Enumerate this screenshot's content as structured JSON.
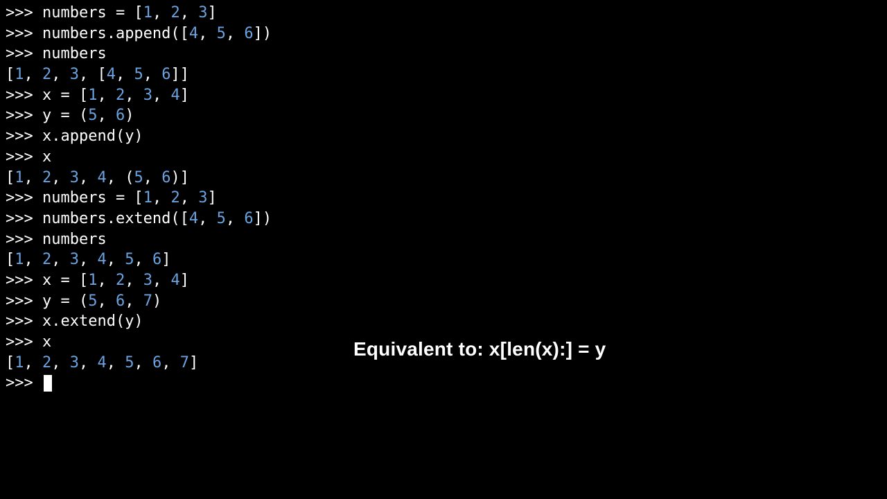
{
  "prompt": ">>> ",
  "lines": [
    {
      "type": "input",
      "tokens": [
        "numbers = [",
        {
          "n": "1"
        },
        ", ",
        {
          "n": "2"
        },
        ", ",
        {
          "n": "3"
        },
        "]"
      ]
    },
    {
      "type": "input",
      "tokens": [
        "numbers.append([",
        {
          "n": "4"
        },
        ", ",
        {
          "n": "5"
        },
        ", ",
        {
          "n": "6"
        },
        "])"
      ]
    },
    {
      "type": "input",
      "tokens": [
        "numbers"
      ]
    },
    {
      "type": "output",
      "tokens": [
        "[",
        {
          "n": "1"
        },
        ", ",
        {
          "n": "2"
        },
        ", ",
        {
          "n": "3"
        },
        ", [",
        {
          "n": "4"
        },
        ", ",
        {
          "n": "5"
        },
        ", ",
        {
          "n": "6"
        },
        "]]"
      ]
    },
    {
      "type": "input",
      "tokens": [
        "x = [",
        {
          "n": "1"
        },
        ", ",
        {
          "n": "2"
        },
        ", ",
        {
          "n": "3"
        },
        ", ",
        {
          "n": "4"
        },
        "]"
      ]
    },
    {
      "type": "input",
      "tokens": [
        "y = (",
        {
          "n": "5"
        },
        ", ",
        {
          "n": "6"
        },
        ")"
      ]
    },
    {
      "type": "input",
      "tokens": [
        "x.append(y)"
      ]
    },
    {
      "type": "input",
      "tokens": [
        "x"
      ]
    },
    {
      "type": "output",
      "tokens": [
        "[",
        {
          "n": "1"
        },
        ", ",
        {
          "n": "2"
        },
        ", ",
        {
          "n": "3"
        },
        ", ",
        {
          "n": "4"
        },
        ", (",
        {
          "n": "5"
        },
        ", ",
        {
          "n": "6"
        },
        ")]"
      ]
    },
    {
      "type": "input",
      "tokens": [
        "numbers = [",
        {
          "n": "1"
        },
        ", ",
        {
          "n": "2"
        },
        ", ",
        {
          "n": "3"
        },
        "]"
      ]
    },
    {
      "type": "input",
      "tokens": [
        "numbers.extend([",
        {
          "n": "4"
        },
        ", ",
        {
          "n": "5"
        },
        ", ",
        {
          "n": "6"
        },
        "])"
      ]
    },
    {
      "type": "input",
      "tokens": [
        "numbers"
      ]
    },
    {
      "type": "output",
      "tokens": [
        "[",
        {
          "n": "1"
        },
        ", ",
        {
          "n": "2"
        },
        ", ",
        {
          "n": "3"
        },
        ", ",
        {
          "n": "4"
        },
        ", ",
        {
          "n": "5"
        },
        ", ",
        {
          "n": "6"
        },
        "]"
      ]
    },
    {
      "type": "input",
      "tokens": [
        "x = [",
        {
          "n": "1"
        },
        ", ",
        {
          "n": "2"
        },
        ", ",
        {
          "n": "3"
        },
        ", ",
        {
          "n": "4"
        },
        "]"
      ]
    },
    {
      "type": "input",
      "tokens": [
        "y = (",
        {
          "n": "5"
        },
        ", ",
        {
          "n": "6"
        },
        ", ",
        {
          "n": "7"
        },
        ")"
      ]
    },
    {
      "type": "input",
      "tokens": [
        "x.extend(y)"
      ]
    },
    {
      "type": "input",
      "tokens": [
        "x"
      ]
    },
    {
      "type": "output",
      "tokens": [
        "[",
        {
          "n": "1"
        },
        ", ",
        {
          "n": "2"
        },
        ", ",
        {
          "n": "3"
        },
        ", ",
        {
          "n": "4"
        },
        ", ",
        {
          "n": "5"
        },
        ", ",
        {
          "n": "6"
        },
        ", ",
        {
          "n": "7"
        },
        "]"
      ]
    },
    {
      "type": "input-cursor",
      "tokens": []
    }
  ],
  "annotation": "Equivalent to:  x[len(x):] = y"
}
